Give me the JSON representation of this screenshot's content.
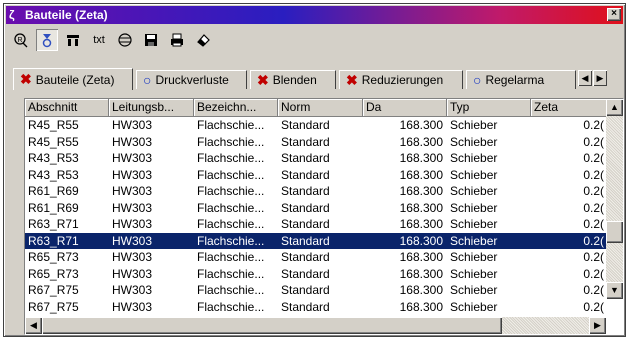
{
  "window": {
    "title": "Bauteile (Zeta)",
    "title_icon": "zeta-icon",
    "close_label": "×"
  },
  "toolbar": {
    "items": [
      {
        "name": "filter-icon",
        "label": ""
      },
      {
        "name": "sort-icon",
        "label": ""
      },
      {
        "name": "columns-icon",
        "label": ""
      },
      {
        "name": "text-export-button",
        "label": "txt"
      },
      {
        "name": "table-icon",
        "label": ""
      },
      {
        "name": "save-icon",
        "label": ""
      },
      {
        "name": "print-icon",
        "label": ""
      },
      {
        "name": "eraser-icon",
        "label": ""
      }
    ]
  },
  "tabs": [
    {
      "label": "Bauteile (Zeta)",
      "icon": "x",
      "active": true
    },
    {
      "label": "Druckverluste",
      "icon": "o",
      "active": false
    },
    {
      "label": "Blenden",
      "icon": "x",
      "active": false
    },
    {
      "label": "Reduzierungen",
      "icon": "x",
      "active": false
    },
    {
      "label": "Regelarma",
      "icon": "o",
      "active": false
    }
  ],
  "table": {
    "columns": [
      "Abschnitt",
      "Leitungsb...",
      "Bezeichn...",
      "Norm",
      "Da",
      "Typ",
      "Zeta"
    ],
    "rows": [
      [
        "R45_R55",
        "HW303",
        "Flachschie...",
        "Standard",
        "168.300",
        "Schieber",
        "0.2("
      ],
      [
        "R45_R55",
        "HW303",
        "Flachschie...",
        "Standard",
        "168.300",
        "Schieber",
        "0.2("
      ],
      [
        "R43_R53",
        "HW303",
        "Flachschie...",
        "Standard",
        "168.300",
        "Schieber",
        "0.2("
      ],
      [
        "R43_R53",
        "HW303",
        "Flachschie...",
        "Standard",
        "168.300",
        "Schieber",
        "0.2("
      ],
      [
        "R61_R69",
        "HW303",
        "Flachschie...",
        "Standard",
        "168.300",
        "Schieber",
        "0.2("
      ],
      [
        "R61_R69",
        "HW303",
        "Flachschie...",
        "Standard",
        "168.300",
        "Schieber",
        "0.2("
      ],
      [
        "R63_R71",
        "HW303",
        "Flachschie...",
        "Standard",
        "168.300",
        "Schieber",
        "0.2("
      ],
      [
        "R63_R71",
        "HW303",
        "Flachschie...",
        "Standard",
        "168.300",
        "Schieber",
        "0.2("
      ],
      [
        "R65_R73",
        "HW303",
        "Flachschie...",
        "Standard",
        "168.300",
        "Schieber",
        "0.2("
      ],
      [
        "R65_R73",
        "HW303",
        "Flachschie...",
        "Standard",
        "168.300",
        "Schieber",
        "0.2("
      ],
      [
        "R67_R75",
        "HW303",
        "Flachschie...",
        "Standard",
        "168.300",
        "Schieber",
        "0.2("
      ],
      [
        "R67_R75",
        "HW303",
        "Flachschie...",
        "Standard",
        "168.300",
        "Schieber",
        "0.2("
      ]
    ],
    "selected_row": 7
  },
  "colors": {
    "selection": "#0a246a",
    "face": "#d4d0c8"
  }
}
